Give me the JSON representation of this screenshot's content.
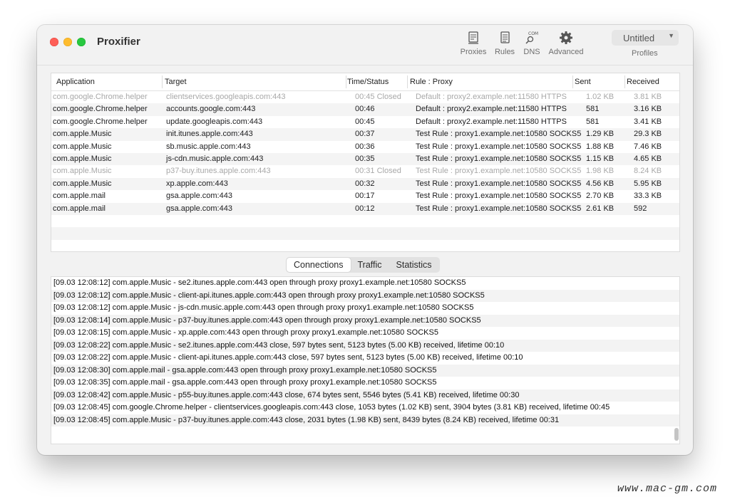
{
  "window": {
    "title": "Proxifier"
  },
  "toolbar": {
    "proxies_label": "Proxies",
    "rules_label": "Rules",
    "dns_label": "DNS",
    "dns_icon_text": "COM",
    "advanced_label": "Advanced",
    "profile_name": "Untitled",
    "profiles_label": "Profiles"
  },
  "table": {
    "columns": [
      "Application",
      "Target",
      "Time/Status",
      "Rule : Proxy",
      "Sent",
      "Received"
    ],
    "rows": [
      {
        "app": "com.google.Chrome.helper",
        "target": "clientservices.googleapis.com:443",
        "time": "00:45 Closed",
        "rule": "Default : proxy2.example.net:11580 HTTPS",
        "sent": "1.02 KB",
        "received": "3.81 KB",
        "closed": true
      },
      {
        "app": "com.google.Chrome.helper",
        "target": "accounts.google.com:443",
        "time": "00:46",
        "rule": "Default : proxy2.example.net:11580 HTTPS",
        "sent": "581",
        "received": "3.16 KB",
        "closed": false
      },
      {
        "app": "com.google.Chrome.helper",
        "target": "update.googleapis.com:443",
        "time": "00:45",
        "rule": "Default : proxy2.example.net:11580 HTTPS",
        "sent": "581",
        "received": "3.41 KB",
        "closed": false
      },
      {
        "app": "com.apple.Music",
        "target": "init.itunes.apple.com:443",
        "time": "00:37",
        "rule": "Test Rule : proxy1.example.net:10580 SOCKS5",
        "sent": "1.29 KB",
        "received": "29.3 KB",
        "closed": false
      },
      {
        "app": "com.apple.Music",
        "target": "sb.music.apple.com:443",
        "time": "00:36",
        "rule": "Test Rule : proxy1.example.net:10580 SOCKS5",
        "sent": "1.88 KB",
        "received": "7.46 KB",
        "closed": false
      },
      {
        "app": "com.apple.Music",
        "target": "js-cdn.music.apple.com:443",
        "time": "00:35",
        "rule": "Test Rule : proxy1.example.net:10580 SOCKS5",
        "sent": "1.15 KB",
        "received": "4.65 KB",
        "closed": false
      },
      {
        "app": "com.apple.Music",
        "target": "p37-buy.itunes.apple.com:443",
        "time": "00:31 Closed",
        "rule": "Test Rule : proxy1.example.net:10580 SOCKS5",
        "sent": "1.98 KB",
        "received": "8.24 KB",
        "closed": true
      },
      {
        "app": "com.apple.Music",
        "target": "xp.apple.com:443",
        "time": "00:32",
        "rule": "Test Rule : proxy1.example.net:10580 SOCKS5",
        "sent": "4.56 KB",
        "received": "5.95 KB",
        "closed": false
      },
      {
        "app": "com.apple.mail",
        "target": "gsa.apple.com:443",
        "time": "00:17",
        "rule": "Test Rule : proxy1.example.net:10580 SOCKS5",
        "sent": "2.70 KB",
        "received": "33.3 KB",
        "closed": false
      },
      {
        "app": "com.apple.mail",
        "target": "gsa.apple.com:443",
        "time": "00:12",
        "rule": "Test Rule : proxy1.example.net:10580 SOCKS5",
        "sent": "2.61 KB",
        "received": "592",
        "closed": false
      }
    ]
  },
  "tabs": [
    {
      "label": "Connections",
      "active": true
    },
    {
      "label": "Traffic",
      "active": false
    },
    {
      "label": "Statistics",
      "active": false
    }
  ],
  "log": [
    "[09.03 12:08:12] com.apple.Music - se2.itunes.apple.com:443 open through proxy proxy1.example.net:10580 SOCKS5",
    "[09.03 12:08:12] com.apple.Music - client-api.itunes.apple.com:443 open through proxy proxy1.example.net:10580 SOCKS5",
    "[09.03 12:08:12] com.apple.Music - js-cdn.music.apple.com:443 open through proxy proxy1.example.net:10580 SOCKS5",
    "[09.03 12:08:14] com.apple.Music - p37-buy.itunes.apple.com:443 open through proxy proxy1.example.net:10580 SOCKS5",
    "[09.03 12:08:15] com.apple.Music - xp.apple.com:443 open through proxy proxy1.example.net:10580 SOCKS5",
    "[09.03 12:08:22] com.apple.Music - se2.itunes.apple.com:443 close, 597 bytes sent, 5123 bytes (5.00 KB) received, lifetime 00:10",
    "[09.03 12:08:22] com.apple.Music - client-api.itunes.apple.com:443 close, 597 bytes sent, 5123 bytes (5.00 KB) received, lifetime 00:10",
    "[09.03 12:08:30] com.apple.mail - gsa.apple.com:443 open through proxy proxy1.example.net:10580 SOCKS5",
    "[09.03 12:08:35] com.apple.mail - gsa.apple.com:443 open through proxy proxy1.example.net:10580 SOCKS5",
    "[09.03 12:08:42] com.apple.Music - p55-buy.itunes.apple.com:443 close, 674 bytes sent, 5546 bytes (5.41 KB) received, lifetime 00:30",
    "[09.03 12:08:45] com.google.Chrome.helper - clientservices.googleapis.com:443 close, 1053 bytes (1.02 KB) sent, 3904 bytes (3.81 KB) received, lifetime 00:45",
    "[09.03 12:08:45] com.apple.Music - p37-buy.itunes.apple.com:443 close, 2031 bytes (1.98 KB) sent, 8439 bytes (8.24 KB) received, lifetime 00:31"
  ],
  "watermark": "www.mac-gm.com"
}
